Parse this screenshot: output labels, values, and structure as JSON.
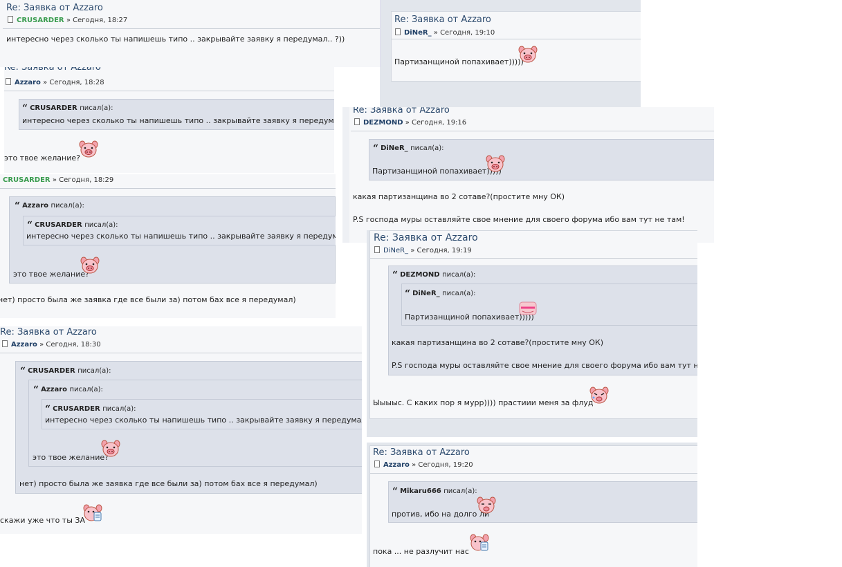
{
  "posts": {
    "p1": {
      "title": "Re: Заявка от Azzaro",
      "author": "CRUSARDER",
      "date": "» Сегодня, 18:27",
      "text": "интересно через сколько ты напишешь типо .. закрывайте заявку я передумал.. ?))"
    },
    "p2": {
      "title": "Re: Заявка от Azzaro",
      "author": "DiNeR_",
      "date": "» Сегодня, 19:10",
      "text": "Партизанщиной попахивает)))))"
    },
    "p3": {
      "title": "Re: Заявка от Azzaro",
      "author": "Azzaro",
      "date": "» Сегодня, 18:28",
      "quote_author": "CRUSARDER",
      "quote_suffix": "писал(а):",
      "quote_text": "интересно через сколько ты напишешь типо .. закрывайте заявку я передумал.. ?))",
      "text": "это твое желание?"
    },
    "p4": {
      "author": "CRUSARDER",
      "date": "» Сегодня, 18:29",
      "quote1_author": "Azzaro",
      "quote2_author": "CRUSARDER",
      "quote_suffix": "писал(а):",
      "quote2_text": "интересно через сколько ты напишешь типо .. закрывайте заявку я передумал.. ?))",
      "quote1_text": "это твое желание?",
      "text": "нет) просто была же заявка где все были за) потом бах все я передумал)"
    },
    "p5": {
      "title": "Re: Заявка от Azzaro",
      "author": "DEZMOND",
      "date": "» Сегодня, 19:16",
      "quote_author": "DiNeR_",
      "quote_suffix": "писал(а):",
      "quote_text": "Партизанщиной попахивает)))))",
      "text1": "какая партизанщина во 2 сотаве?(простите мну ОК)",
      "text2": "P.S господа муры оставляйте свое мнение для своего форума ибо вам тут не там!"
    },
    "p6": {
      "title": "Re: Заявка от Azzaro",
      "author": "DiNeR_",
      "date": "» Сегодня, 19:19",
      "quote1_author": "DEZMOND",
      "quote2_author": "DiNeR_",
      "quote_suffix": "писал(а):",
      "quote2_text": "Партизанщиной попахивает)))))",
      "quote1_text1": "какая партизанщина во 2 сотаве?(простите мну ОК)",
      "quote1_text2": "P.S господа муры оставляйте свое мнение для своего форума ибо вам тут не там!",
      "text": "Ыыыыс. С каких пор я мурр)))) прастиии меня за флуд"
    },
    "p7": {
      "title": "Re: Заявка от Azzaro",
      "author": "Azzaro",
      "date": "» Сегодня, 18:30",
      "quote1_author": "CRUSARDER",
      "quote2_author": "Azzaro",
      "quote3_author": "CRUSARDER",
      "quote_suffix": "писал(а):",
      "quote3_text": "интересно через сколько ты напишешь типо .. закрывайте заявку я передумал.. ?))",
      "quote2_text": "это твое желание?",
      "quote1_text": "нет) просто была же заявка где все были за) потом бах все я передумал)",
      "text": "скажи уже что ты ЗА"
    },
    "p8": {
      "title": "Re: Заявка от Azzaro",
      "author": "Azzaro",
      "date": "» Сегодня, 19:20",
      "quote_author": "Mikaru666",
      "quote_suffix": "писал(а):",
      "quote_text": "против, ибо на долго ли",
      "text": "пока ... не разлучит нас"
    }
  },
  "quote_mark": "“",
  "icons": {
    "pig": "pig-smiley-icon",
    "doc": "post-document-icon"
  }
}
